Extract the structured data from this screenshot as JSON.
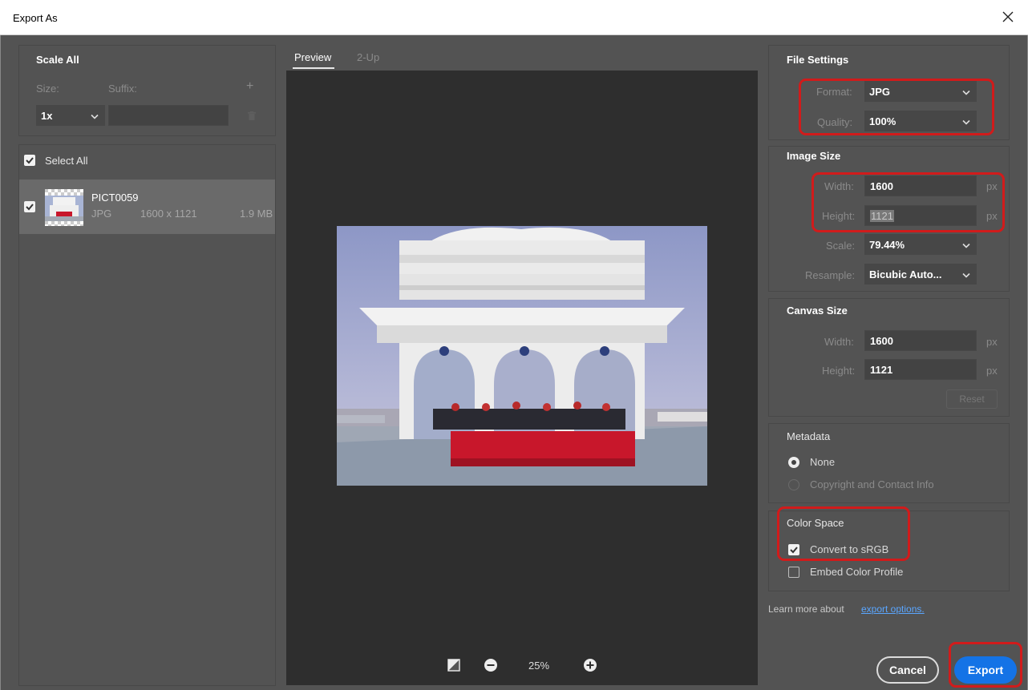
{
  "window": {
    "title": "Export As"
  },
  "scale_all": {
    "heading": "Scale All",
    "size_label": "Size:",
    "suffix_label": "Suffix:",
    "size_value": "1x",
    "suffix_value": "",
    "add_glyph": "+"
  },
  "assets": {
    "select_all_label": "Select All",
    "items": [
      {
        "name": "PICT0059",
        "format": "JPG",
        "dimensions": "1600 x 1121",
        "size": "1.9 MB"
      }
    ]
  },
  "preview": {
    "tabs": [
      {
        "label": "Preview"
      },
      {
        "label": "2-Up"
      }
    ],
    "zoom": "25%"
  },
  "file_settings": {
    "heading": "File Settings",
    "format_label": "Format:",
    "format_value": "JPG",
    "quality_label": "Quality:",
    "quality_value": "100%"
  },
  "image_size": {
    "heading": "Image Size",
    "width_label": "Width:",
    "width_value": "1600",
    "height_label": "Height:",
    "height_value": "1121",
    "unit": "px",
    "scale_label": "Scale:",
    "scale_value": "79.44%",
    "resample_label": "Resample:",
    "resample_value": "Bicubic Auto..."
  },
  "canvas_size": {
    "heading": "Canvas Size",
    "width_label": "Width:",
    "width_value": "1600",
    "height_label": "Height:",
    "height_value": "1121",
    "unit": "px",
    "reset_label": "Reset"
  },
  "metadata": {
    "heading": "Metadata",
    "options": [
      {
        "label": "None",
        "selected": true
      },
      {
        "label": "Copyright and Contact Info",
        "selected": false
      }
    ]
  },
  "color_space": {
    "heading": "Color Space",
    "convert_label": "Convert to sRGB",
    "convert_checked": true,
    "embed_label": "Embed Color Profile",
    "embed_checked": false
  },
  "footer": {
    "learn_more": "Learn more about",
    "learn_link": "export options.",
    "cancel_label": "Cancel",
    "export_label": "Export"
  },
  "colors": {
    "accent": "#1473e6",
    "highlight": "#d11b1b",
    "panel_bg": "#535353",
    "preview_bg": "#2e2e2e"
  }
}
